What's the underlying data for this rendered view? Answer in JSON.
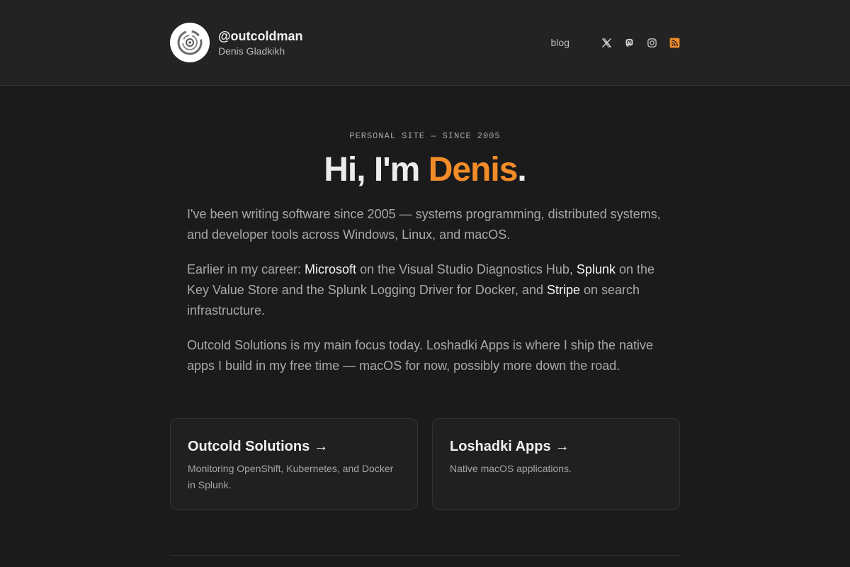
{
  "header": {
    "handle": "@outcoldman",
    "name": "Denis Gladkikh",
    "nav": {
      "blog_label": "blog"
    },
    "social": [
      {
        "icon": "x-icon"
      },
      {
        "icon": "mastodon-icon"
      },
      {
        "icon": "instagram-icon"
      },
      {
        "icon": "rss-icon",
        "color": "#f28c28"
      }
    ]
  },
  "hero": {
    "eyebrow": "PERSONAL SITE — SINCE 2005",
    "title_prefix": "Hi, I'm ",
    "title_name": "Denis",
    "title_suffix": ".",
    "accent_color": "#f28c28",
    "para1": "I've been writing software since 2005 — systems programming, distributed systems, and developer tools across Windows, Linux, and macOS.",
    "para2": {
      "t1": "Earlier in my career: ",
      "link1": "Microsoft",
      "t2": " on the Visual Studio Diagnostics Hub, ",
      "link2": "Splunk",
      "t3": " on the Key Value Store and the Splunk Logging Driver for Docker, and ",
      "link3": "Stripe",
      "t4": " on search infrastructure."
    },
    "para3": "Outcold Solutions is my main focus today. Loshadki Apps is where I ship the native apps I build in my free time — macOS for now, possibly more down the road."
  },
  "cards": [
    {
      "title": "Outcold Solutions",
      "arrow": "→",
      "desc": "Monitoring OpenShift, Kubernetes, and Docker in Splunk."
    },
    {
      "title": "Loshadki Apps",
      "arrow": "→",
      "desc": "Native macOS applications."
    }
  ]
}
